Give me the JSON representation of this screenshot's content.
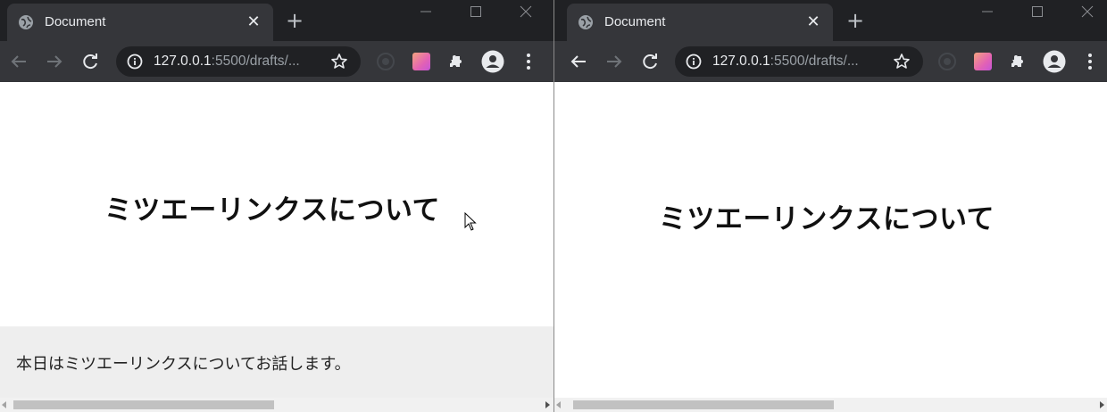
{
  "colors": {
    "tab_strip": "#202124",
    "toolbar": "#35363a",
    "omnibox": "#202124",
    "intro_bg": "#eeeeee"
  },
  "windows": [
    {
      "tab": {
        "title": "Document",
        "favicon": "globe-icon",
        "close": "✕"
      },
      "new_tab": "+",
      "url": {
        "host": "127.0.0.1",
        "rest": ":5500/drafts/..."
      },
      "page": {
        "heading": "ミツエーリンクスについて",
        "intro": "本日はミツエーリンクスについてお話します。"
      }
    },
    {
      "tab": {
        "title": "Document",
        "favicon": "globe-icon",
        "close": "✕"
      },
      "new_tab": "+",
      "url": {
        "host": "127.0.0.1",
        "rest": ":5500/drafts/..."
      },
      "page": {
        "heading": "ミツエーリンクスについて"
      }
    }
  ],
  "icons": [
    "back-icon",
    "forward-icon",
    "reload-icon",
    "info-icon",
    "star-icon",
    "extensions-icon",
    "profile-icon",
    "menu-icon"
  ]
}
